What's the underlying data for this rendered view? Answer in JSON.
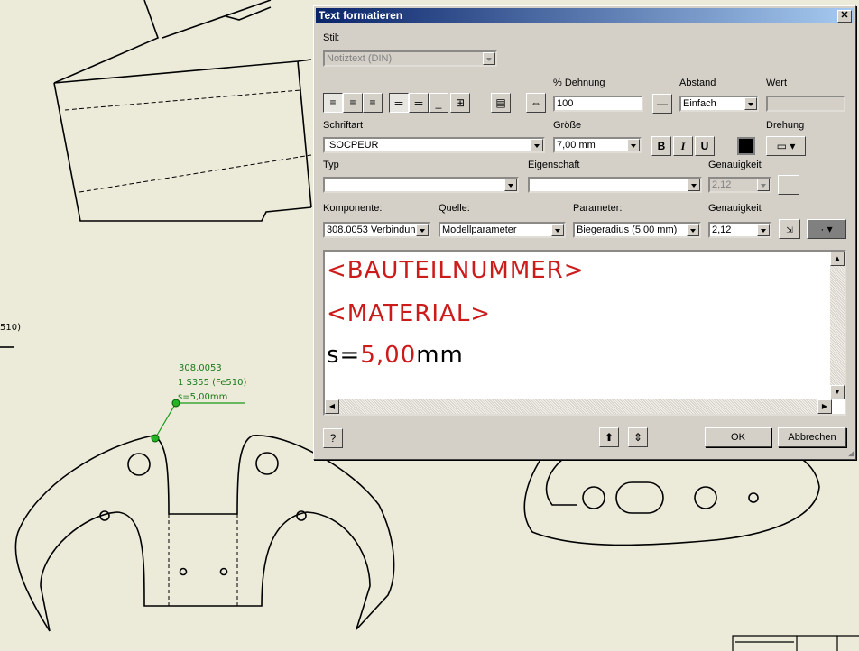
{
  "window": {
    "title": "Text formatieren"
  },
  "labels": {
    "stil": "Stil:",
    "dehnung": "% Dehnung",
    "abstand": "Abstand",
    "wert": "Wert",
    "schriftart": "Schriftart",
    "groesse": "Größe",
    "drehung": "Drehung",
    "typ": "Typ",
    "eigenschaft": "Eigenschaft",
    "genauigkeit1": "Genauigkeit",
    "komponente": "Komponente:",
    "quelle": "Quelle:",
    "parameter": "Parameter:",
    "genauigkeit2": "Genauigkeit"
  },
  "fields": {
    "stil": "Notiztext (DIN)",
    "dehnung": "100",
    "abstand": "Einfach",
    "wert": "",
    "schriftart": "ISOCPEUR",
    "groesse": "7,00 mm",
    "typ": "",
    "eigenschaft": "",
    "genauigkeit1": "2,12",
    "komponente": "308.0053 Verbindun",
    "quelle": "Modellparameter",
    "parameter": "Biegeradius (5,00 mm)",
    "genauigkeit2": "2,12"
  },
  "format_buttons": {
    "bold": "B",
    "italic": "I",
    "underline": "U"
  },
  "editor": {
    "line1": "<BAUTEILNUMMER>",
    "line2": "<MATERIAL>",
    "line3_prefix": "s=",
    "line3_value": "5,00",
    "line3_suffix": "mm"
  },
  "buttons": {
    "help": "?",
    "ok": "OK",
    "cancel": "Abbrechen"
  },
  "annotation": {
    "line1": "308.0053",
    "line2": "1 S355 (Fe510)",
    "line3": "s=5,00mm"
  },
  "background_text": {
    "left_stub": "510)"
  },
  "colors": {
    "title_start": "#0a246a",
    "title_end": "#a6caf0",
    "red_text": "#cc1b1b",
    "annotation_green": "#1a7a1a"
  }
}
